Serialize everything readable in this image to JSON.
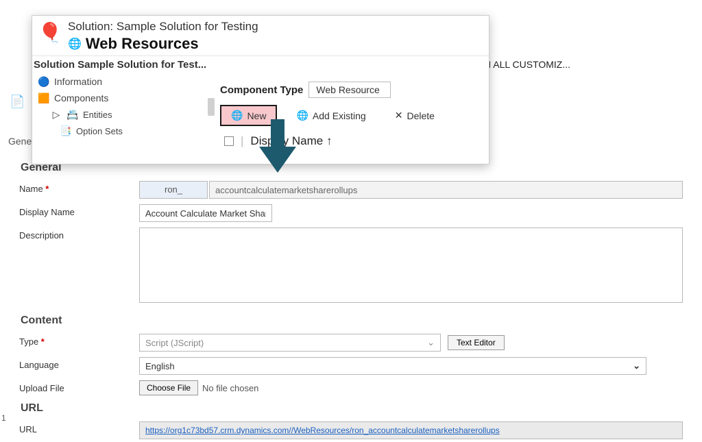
{
  "background": {
    "truncated_toolbar": "H ALL CUSTOMIZ...",
    "left_tab": "Gene"
  },
  "popup": {
    "solution_line": "Solution: Sample Solution for Testing",
    "title": "Web Resources",
    "breadcrumb": "Solution Sample Solution for Test...",
    "nav": {
      "information": "Information",
      "components": "Components",
      "entities": "Entities",
      "option_sets": "Option Sets"
    },
    "component_type_label": "Component Type",
    "component_type_value": "Web Resource",
    "buttons": {
      "new": "New",
      "add_existing": "Add Existing",
      "delete": "Delete"
    },
    "column_header": "Display Name ↑"
  },
  "form": {
    "sections": {
      "general": "General",
      "content": "Content",
      "url": "URL"
    },
    "labels": {
      "name": "Name",
      "display_name": "Display Name",
      "description": "Description",
      "type": "Type",
      "language": "Language",
      "upload_file": "Upload File",
      "url": "URL"
    },
    "values": {
      "name_prefix": "ron_",
      "name_suffix": "accountcalculatemarketsharerollups",
      "display_name": "Account Calculate Market Share Rollups",
      "description": "",
      "type": "Script (JScript)",
      "language": "English",
      "file_status": "No file chosen",
      "url": "https://org1c73bd57.crm.dynamics.com//WebResources/ron_accountcalculatemarketsharerollups"
    },
    "buttons": {
      "text_editor": "Text Editor",
      "choose_file": "Choose File"
    }
  },
  "page_number": "1"
}
